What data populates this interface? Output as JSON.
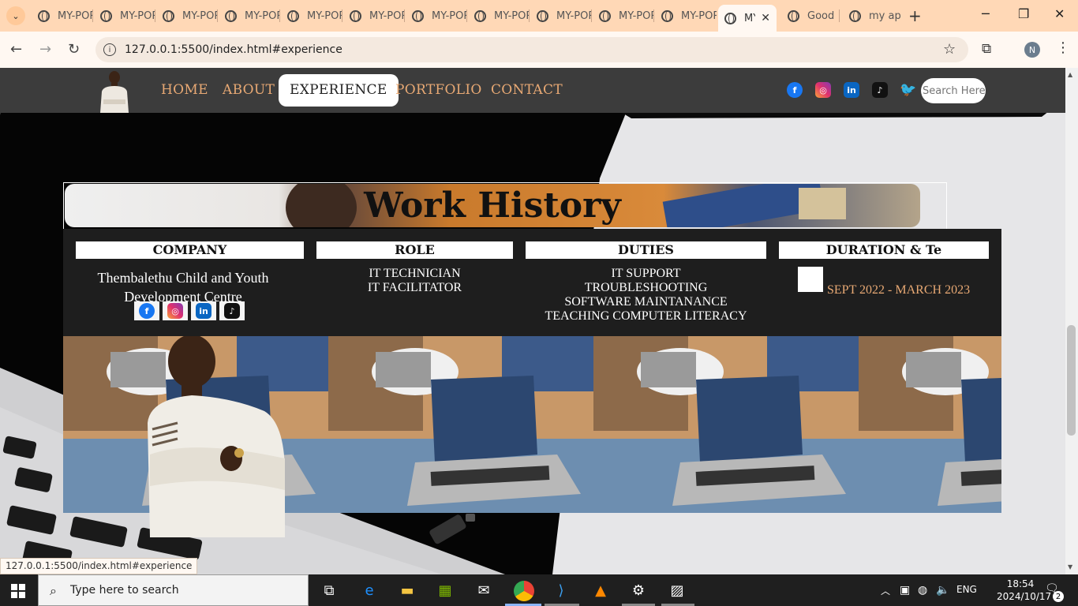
{
  "browser": {
    "tabs": [
      {
        "label": "MY-PORTFOLIO"
      },
      {
        "label": "MY-PORTFOLIO"
      },
      {
        "label": "MY-PORTFOLIO"
      },
      {
        "label": "MY-PORTFOLIO"
      },
      {
        "label": "MY-PORTFOLIO"
      },
      {
        "label": "MY-PORTFOLIO"
      },
      {
        "label": "MY-PORTFOLIO"
      },
      {
        "label": "MY-PORTFOLIO"
      },
      {
        "label": "MY-PORTFOLIO"
      },
      {
        "label": "MY-PORTFOLIO"
      },
      {
        "label": "MY-PORTFOLIO"
      },
      {
        "label": "MY-PORTFOLIO",
        "active": true
      },
      {
        "label": "Good"
      },
      {
        "label": "my app"
      }
    ],
    "url": "127.0.0.1:5500/index.html#experience",
    "profile_initial": "N",
    "status_url": "127.0.0.1:5500/index.html#experience"
  },
  "site": {
    "nav": {
      "home": "HOME",
      "about": "ABOUT",
      "experience": "EXPERIENCE",
      "portfolio": "PORTFOLIO",
      "contact": "CONTACT"
    },
    "social_icons": [
      "facebook-icon",
      "instagram-icon",
      "linkedin-icon",
      "tiktok-icon",
      "twitter-icon"
    ],
    "search_placeholder": "Search Here",
    "banner_title": "Work History",
    "table": {
      "headers": {
        "company": "COMPANY",
        "role": "ROLE",
        "duties": "DUTIES",
        "duration": "DURATION & Te"
      },
      "company_line1": "Thembalethu Child and Youth",
      "company_line2": "Development Centre",
      "roles": [
        "IT TECHNICIAN",
        "IT FACILITATOR"
      ],
      "duties": [
        "IT SUPPORT",
        "TROUBLESHOOTING",
        "SOFTWARE MAINTANANCE",
        "TEACHING COMPUTER LITERACY"
      ],
      "duration": "SEPT 2022 - MARCH 2023"
    },
    "colors": {
      "accent": "#e8a974",
      "nav_bg": "#3c3c3c",
      "panel_bg": "#1e1e1e"
    }
  },
  "taskbar": {
    "search_text": "Type here to search",
    "language": "ENG",
    "time": "18:54",
    "date": "2024/10/17",
    "notification_count": "2"
  }
}
